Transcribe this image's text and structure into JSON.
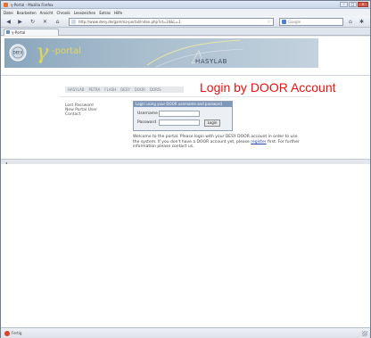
{
  "window": {
    "title": "γ-Portal - Mozilla Firefox"
  },
  "menu": [
    "Datei",
    "Bearbeiten",
    "Ansicht",
    "Chronik",
    "Lesezeichen",
    "Extras",
    "Hilfe"
  ],
  "nav": {
    "url": "http://www.desy.de/gamma-portal/index.php?id=24&L=1",
    "search_placeholder": "Google"
  },
  "tab": {
    "label": "γ-Portal"
  },
  "banner": {
    "gamma": "γ",
    "portal": "-portal",
    "deex": "DEEX",
    "hasylab": "HASYLAB"
  },
  "navlinks": [
    "HASYLAB",
    "PETRA",
    "FLASH",
    "DESY",
    "DOOR",
    "DORIS"
  ],
  "headline": "Login by DOOR Account",
  "left_links": [
    "Lost Password",
    "New Portal User",
    "Contact"
  ],
  "login": {
    "header": "Login using your DOOR username and password",
    "user_label": "Username",
    "password_label": "Password",
    "button": "Login"
  },
  "welcome": {
    "text_before": "Welcome to the portal. Please login with your DESY DOOR account in order to use the system. If you don't have a DOOR account yet, please",
    "link": "register",
    "text_after": "first. For further information please contact us."
  },
  "statusbar": {
    "text": "Fertig"
  }
}
